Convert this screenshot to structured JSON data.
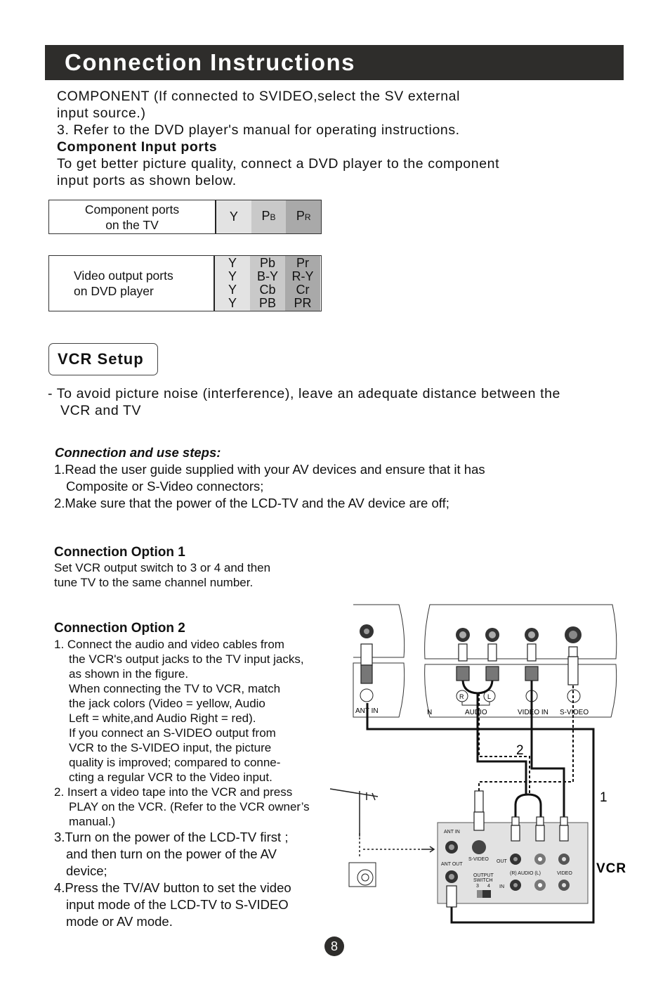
{
  "header": {
    "title": "Connection Instructions"
  },
  "component": {
    "lines": [
      "COMPONENT (If connected to SVIDEO,select the SV external",
      "input source.)",
      "3. Refer to the DVD player's manual for operating instructions."
    ],
    "heading": "Component Input ports",
    "desc": [
      "To get better picture quality, connect a DVD player to the component",
      "input ports as shown below."
    ]
  },
  "table_tv": {
    "label": [
      "Component ports",
      "on the TV"
    ],
    "cols": [
      {
        "main": "Y",
        "sub": ""
      },
      {
        "main": "P",
        "sub": "B"
      },
      {
        "main": "P",
        "sub": "R"
      }
    ]
  },
  "table_dvd": {
    "label": [
      "Video output ports",
      "on DVD player"
    ],
    "cols": [
      [
        "Y",
        "Y",
        "Y",
        "Y"
      ],
      [
        "Pb",
        "B-Y",
        "Cb",
        "PB"
      ],
      [
        "Pr",
        "R-Y",
        "Cr",
        "PR"
      ]
    ]
  },
  "vcr_setup": {
    "title": "VCR Setup",
    "note": [
      "- To avoid picture noise (interference), leave an adequate distance between the",
      "VCR and TV"
    ]
  },
  "steps": {
    "heading": "Connection and use steps:",
    "lines": [
      "1.Read the user guide supplied with your AV devices and ensure that it has",
      "Composite or S-Video connectors;",
      "2.Make sure that the power of the LCD-TV and the AV device are off;"
    ]
  },
  "option1": {
    "heading": "Connection Option 1",
    "lines": [
      "Set VCR output switch to 3 or 4 and then",
      "tune TV to the same channel number."
    ]
  },
  "option2": {
    "heading": "Connection Option 2",
    "lines": [
      "1. Connect the audio and video cables from",
      "the VCR's output jacks to the TV input jacks,",
      "as shown in the figure.",
      "When connecting the TV to VCR, match",
      "the jack colors (Video = yellow, Audio",
      "Left = white,and Audio Right = red).",
      "If you connect an S-VIDEO output from",
      "VCR to the S-VIDEO input, the picture",
      "quality is improved; compared to conne-",
      "cting a regular VCR to the Video input.",
      "2. Insert a video tape into the VCR and press",
      "PLAY on the VCR. (Refer to the VCR owner’s",
      "manual.)"
    ],
    "lines_large": [
      "3.Turn on the power of the LCD-TV first ;",
      "and then turn on the power of the AV",
      "device;",
      "4.Press the TV/AV button to set the video",
      "input mode of the LCD-TV to S-VIDEO",
      "mode or AV mode."
    ]
  },
  "diagram": {
    "tv_ant_in": "ANT IN",
    "tv_n": "N",
    "audio": "AUDIO",
    "video_in": "VIDEO IN",
    "s_video": "S-VIDEO",
    "r": "R",
    "l": "L",
    "label_2": "2",
    "label_1": "1",
    "vcr": "VCR",
    "vcr_ant_in": "ANT IN",
    "vcr_ant_out": "ANT OUT",
    "vcr_s_video": "S-VIDEO",
    "vcr_out": "OUT",
    "vcr_audio": "(R) AUDIO (L)",
    "vcr_video": "VIDEO",
    "vcr_output": "OUTPUT",
    "vcr_switch": "SWITCH",
    "sw3": "3",
    "sw4": "4",
    "vcr_in": "IN"
  },
  "page_number": "8"
}
